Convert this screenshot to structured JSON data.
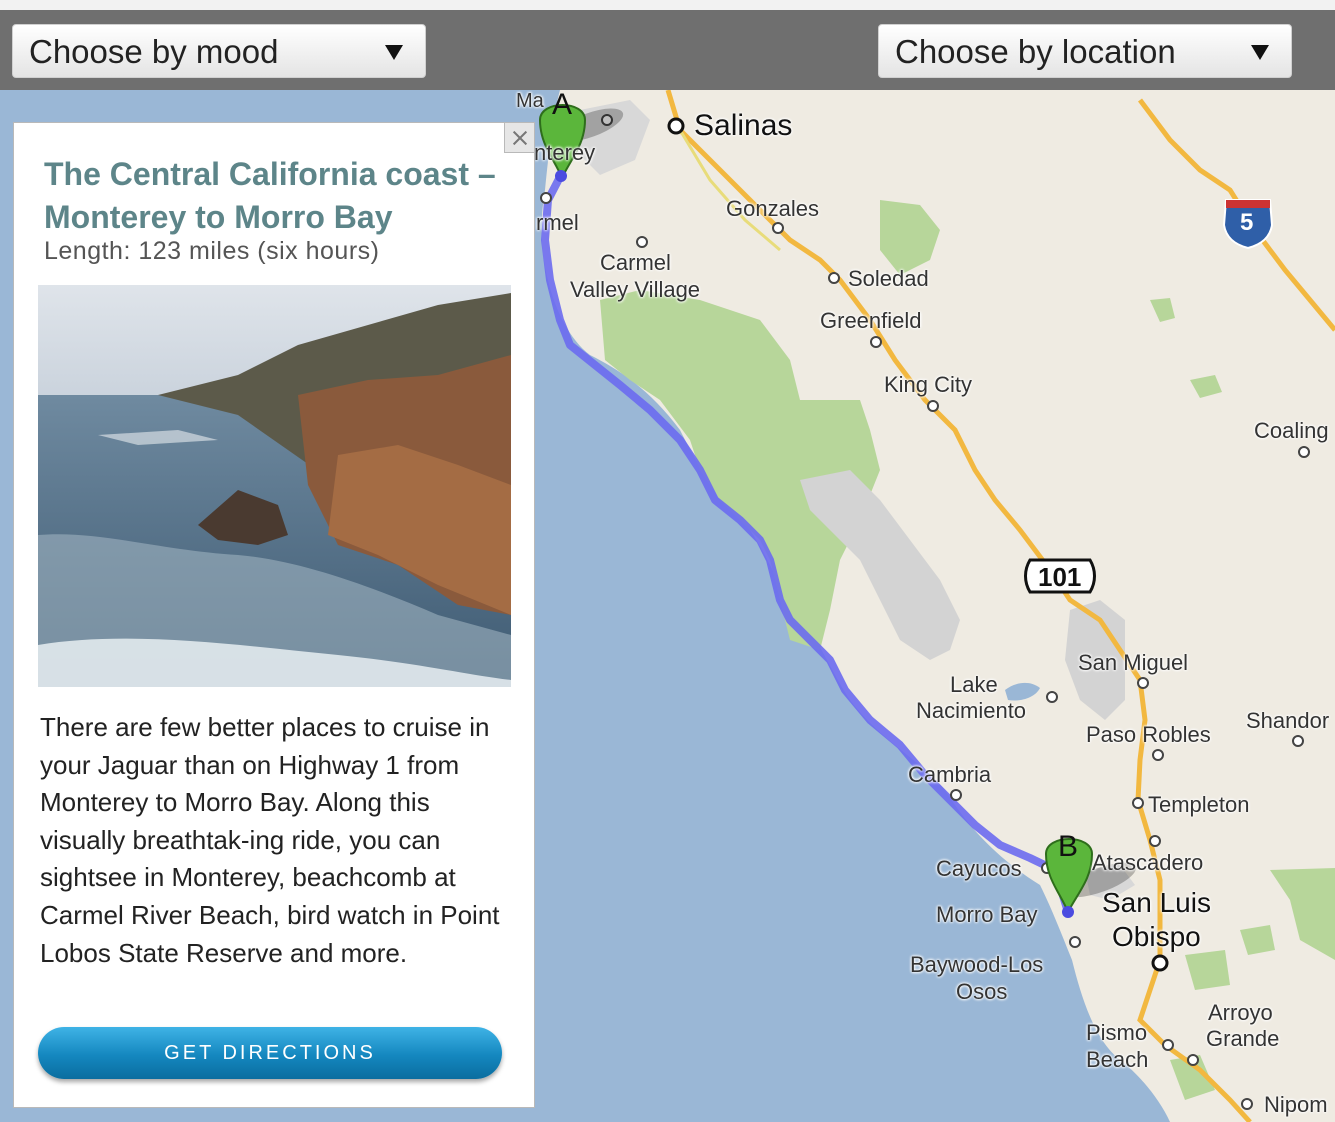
{
  "header": {
    "mood_select": "Choose by mood",
    "location_select": "Choose by location"
  },
  "panel": {
    "title": "The Central California coast – Monterey to Morro Bay",
    "length": "Length: 123 miles (six hours)",
    "description": "There are few better places to cruise in your Jaguar than on Highway 1 from Monterey to Morro Bay. Along this visually breathtak-ing ride, you can sightsee in Monterey, beachcomb at Carmel River Beach, bird watch in Point Lobos State Reserve and more.",
    "button": "GET DIRECTIONS"
  },
  "map": {
    "markers": {
      "start": "A",
      "end": "B"
    },
    "shields": {
      "us_101": "101",
      "i_5": "5"
    },
    "places": {
      "salinas": "Salinas",
      "gonzales": "Gonzales",
      "carmel_valley_1": "Carmel",
      "carmel_valley_2": "Valley Village",
      "soledad": "Soledad",
      "greenfield": "Greenfield",
      "king_city": "King City",
      "coalinga": "Coaling",
      "san_miguel": "San Miguel",
      "lake_nac_1": "Lake",
      "lake_nac_2": "Nacimiento",
      "paso_robles": "Paso Robles",
      "shandon": "Shandor",
      "cambria": "Cambria",
      "templeton": "Templeton",
      "atascadero": "Atascadero",
      "cayucos": "Cayucos",
      "morro_bay": "Morro Bay",
      "slo_1": "San Luis",
      "slo_2": "Obispo",
      "baywood_1": "Baywood-Los",
      "baywood_2": "Osos",
      "arroyo_1": "Arroyo",
      "arroyo_2": "Grande",
      "pismo_1": "Pismo",
      "pismo_2": "Beach",
      "nipomo": "Nipom",
      "monterey_partial": "nterey",
      "carmel_partial": "rmel",
      "marina_partial": "Ma"
    }
  }
}
